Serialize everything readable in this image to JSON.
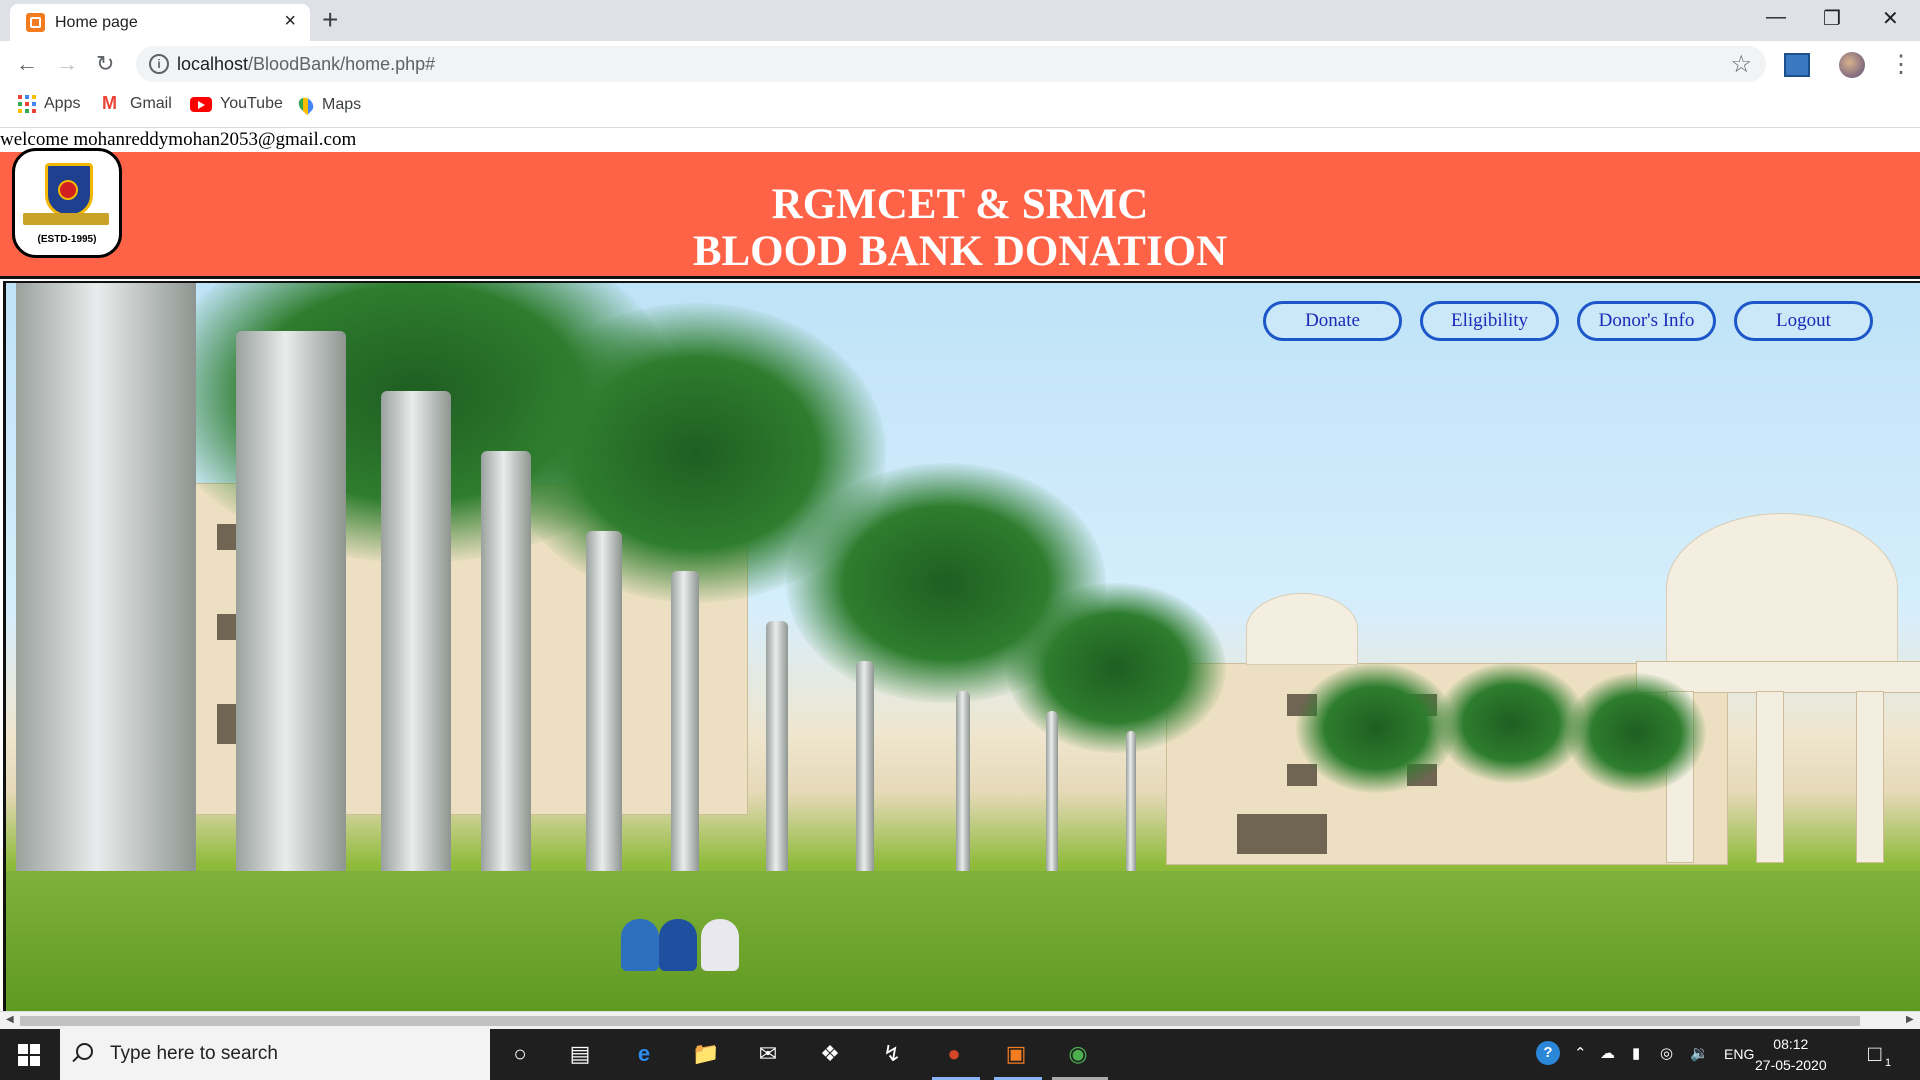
{
  "browser": {
    "tab_title": "Home page",
    "tab_close": "×",
    "new_tab": "+",
    "window_controls": [
      "—",
      "❐",
      "✕"
    ],
    "url_host": "localhost",
    "url_path": "/BloodBank/home.php#",
    "bookmarks": [
      {
        "label": "Apps",
        "icon": "apps-grid-icon"
      },
      {
        "label": "Gmail",
        "icon": "gmail-icon"
      },
      {
        "label": "YouTube",
        "icon": "youtube-icon"
      },
      {
        "label": "Maps",
        "icon": "maps-icon"
      }
    ]
  },
  "page": {
    "welcome": "welcome mohanreddymohan2053@gmail.com",
    "header": {
      "line1": "RGMCET & SRMC",
      "line2": "BLOOD BANK DONATION",
      "logo_text": "(ESTD-1995)",
      "bg_color": "#ff6347"
    },
    "nav": [
      {
        "label": "Donate"
      },
      {
        "label": "Eligibility"
      },
      {
        "label": "Donor's Info"
      },
      {
        "label": "Logout"
      }
    ]
  },
  "taskbar": {
    "search_placeholder": "Type here to search",
    "lang": "ENG",
    "time": "08:12",
    "date": "27-05-2020",
    "notification_count": "1"
  }
}
